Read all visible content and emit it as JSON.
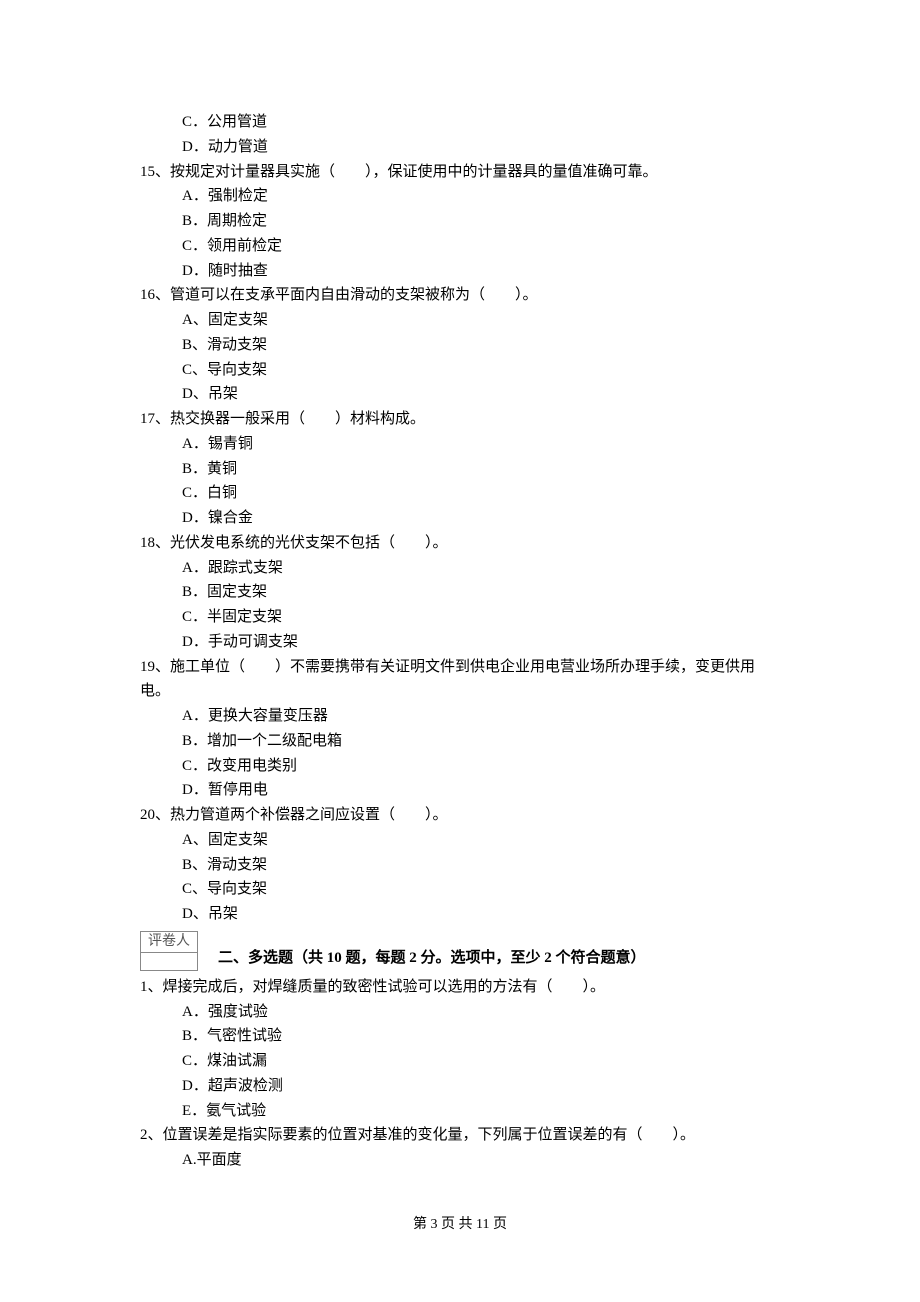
{
  "q14": {
    "opts": {
      "c": "C．公用管道",
      "d": "D．动力管道"
    }
  },
  "q15": {
    "text": "15、按规定对计量器具实施（　　），保证使用中的计量器具的量值准确可靠。",
    "opts": {
      "a": "A．强制检定",
      "b": "B．周期检定",
      "c": "C．领用前检定",
      "d": "D．随时抽查"
    }
  },
  "q16": {
    "text": "16、管道可以在支承平面内自由滑动的支架被称为（　　）。",
    "opts": {
      "a": "A、固定支架",
      "b": "B、滑动支架",
      "c": "C、导向支架",
      "d": "D、吊架"
    }
  },
  "q17": {
    "text": "17、热交换器一般采用（　　）材料构成。",
    "opts": {
      "a": "A．锡青铜",
      "b": "B．黄铜",
      "c": "C．白铜",
      "d": "D．镍合金"
    }
  },
  "q18": {
    "text": "18、光伏发电系统的光伏支架不包括（　　）。",
    "opts": {
      "a": "A．跟踪式支架",
      "b": "B．固定支架",
      "c": "C．半固定支架",
      "d": "D．手动可调支架"
    }
  },
  "q19": {
    "text": "19、施工单位（　　）不需要携带有关证明文件到供电企业用电营业场所办理手续，变更供用电。",
    "opts": {
      "a": "A．更换大容量变压器",
      "b": "B．增加一个二级配电箱",
      "c": "C．改变用电类别",
      "d": "D．暂停用电"
    }
  },
  "q20": {
    "text": "20、热力管道两个补偿器之间应设置（　　）。",
    "opts": {
      "a": "A、固定支架",
      "b": "B、滑动支架",
      "c": "C、导向支架",
      "d": "D、吊架"
    }
  },
  "section2": {
    "grader_label": "评卷人",
    "title": "二、多选题（共 10 题，每题 2 分。选项中，至少 2 个符合题意）"
  },
  "mq1": {
    "text": "1、焊接完成后，对焊缝质量的致密性试验可以选用的方法有（　　）。",
    "opts": {
      "a": "A．强度试验",
      "b": "B．气密性试验",
      "c": "C．煤油试漏",
      "d": "D．超声波检测",
      "e": "E．氨气试验"
    }
  },
  "mq2": {
    "text": "2、位置误差是指实际要素的位置对基准的变化量，下列属于位置误差的有（　　）。",
    "opts": {
      "a": "A.平面度"
    }
  },
  "footer": "第 3 页 共 11 页"
}
